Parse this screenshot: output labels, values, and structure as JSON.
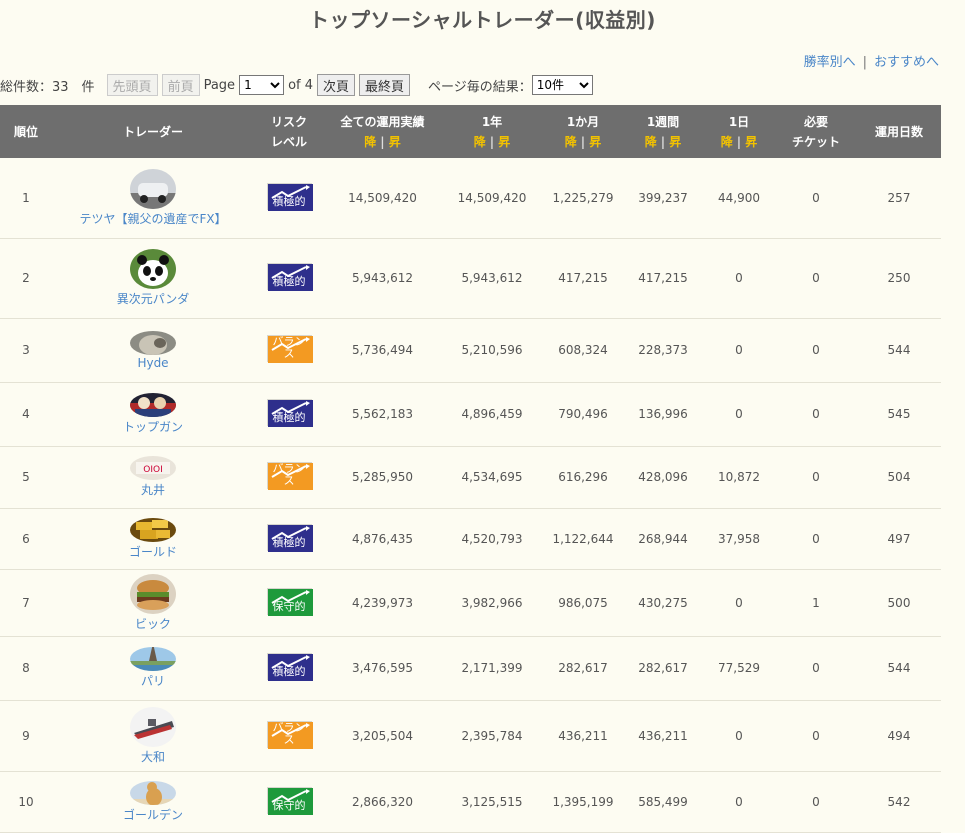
{
  "page": {
    "title": "トップソーシャルトレーダー(収益別)"
  },
  "links": {
    "win_rate": "勝率別へ",
    "separator": "|",
    "recommended": "おすすめへ"
  },
  "pager": {
    "total_label": "総件数：33　件",
    "first": "先頭頁",
    "prev": "前頁",
    "page_label": "Page",
    "page_value": "1",
    "of_label": "of 4",
    "next": "次頁",
    "last": "最終頁",
    "per_page_label": "ページ毎の結果：",
    "per_page_value": "10件"
  },
  "table": {
    "headers": {
      "rank": "順位",
      "trader": "トレーダー",
      "risk_1": "リスク",
      "risk_2": "レベル",
      "total": "全ての運用実績",
      "year": "1年",
      "month": "1か月",
      "week": "1週間",
      "day": "1日",
      "ticket_1": "必要",
      "ticket_2": "チケット",
      "days": "運用日数",
      "sort_desc": "降",
      "sort_sep": "|",
      "sort_asc": "昇"
    },
    "rows": [
      {
        "rank": "1",
        "name": "テツヤ【親父の遺産でFX】",
        "avatar": "car",
        "risk": "積極的",
        "risk_color": "#2e2f8c",
        "total": "14,509,420",
        "year": "14,509,420",
        "month": "1,225,279",
        "week": "399,237",
        "day": "44,900",
        "ticket": "0",
        "days": "257"
      },
      {
        "rank": "2",
        "name": "異次元パンダ",
        "avatar": "panda",
        "risk": "積極的",
        "risk_color": "#2e2f8c",
        "total": "5,943,612",
        "year": "5,943,612",
        "month": "417,215",
        "week": "417,215",
        "day": "0",
        "ticket": "0",
        "days": "250"
      },
      {
        "rank": "3",
        "name": "Hyde",
        "avatar": "animal",
        "risk": "バランス",
        "risk_color": "#f39a22",
        "total": "5,736,494",
        "year": "5,210,596",
        "month": "608,324",
        "week": "228,373",
        "day": "0",
        "ticket": "0",
        "days": "544"
      },
      {
        "rank": "4",
        "name": "トップガン",
        "avatar": "jet",
        "risk": "積極的",
        "risk_color": "#2e2f8c",
        "total": "5,562,183",
        "year": "4,896,459",
        "month": "790,496",
        "week": "136,996",
        "day": "0",
        "ticket": "0",
        "days": "545"
      },
      {
        "rank": "5",
        "name": "丸井",
        "avatar": "sign",
        "risk": "バランス",
        "risk_color": "#f39a22",
        "total": "5,285,950",
        "year": "4,534,695",
        "month": "616,296",
        "week": "428,096",
        "day": "10,872",
        "ticket": "0",
        "days": "504"
      },
      {
        "rank": "6",
        "name": "ゴールド",
        "avatar": "gold",
        "risk": "積極的",
        "risk_color": "#2e2f8c",
        "total": "4,876,435",
        "year": "4,520,793",
        "month": "1,122,644",
        "week": "268,944",
        "day": "37,958",
        "ticket": "0",
        "days": "497"
      },
      {
        "rank": "7",
        "name": "ビック",
        "avatar": "burger",
        "risk": "保守的",
        "risk_color": "#1e9a3c",
        "total": "4,239,973",
        "year": "3,982,966",
        "month": "986,075",
        "week": "430,275",
        "day": "0",
        "ticket": "1",
        "days": "500"
      },
      {
        "rank": "8",
        "name": "パリ",
        "avatar": "paris",
        "risk": "積極的",
        "risk_color": "#2e2f8c",
        "total": "3,476,595",
        "year": "2,171,399",
        "month": "282,617",
        "week": "282,617",
        "day": "77,529",
        "ticket": "0",
        "days": "544"
      },
      {
        "rank": "9",
        "name": "大和",
        "avatar": "ship",
        "risk": "バランス",
        "risk_color": "#f39a22",
        "total": "3,205,504",
        "year": "2,395,784",
        "month": "436,211",
        "week": "436,211",
        "day": "0",
        "ticket": "0",
        "days": "494"
      },
      {
        "rank": "10",
        "name": "ゴールデン",
        "avatar": "dog",
        "risk": "保守的",
        "risk_color": "#1e9a3c",
        "total": "2,866,320",
        "year": "3,125,515",
        "month": "1,395,199",
        "week": "585,499",
        "day": "0",
        "ticket": "0",
        "days": "542"
      }
    ]
  }
}
